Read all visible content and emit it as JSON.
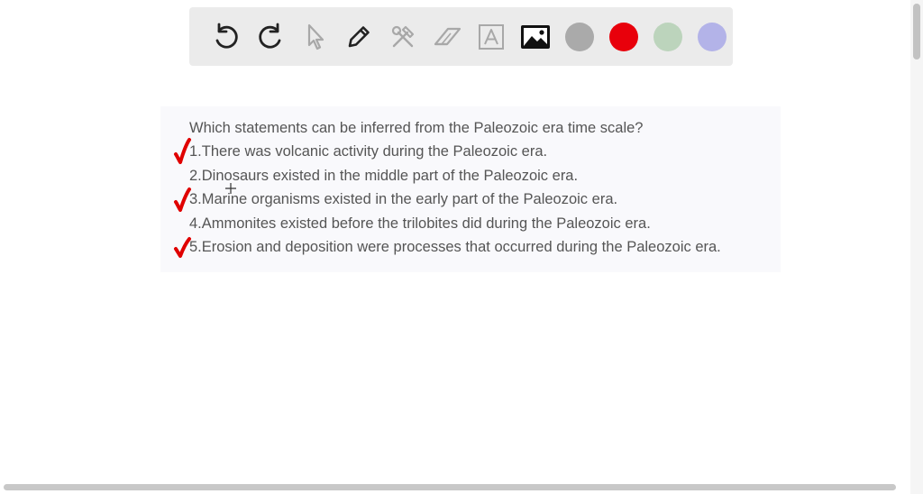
{
  "toolbar": {
    "tools": [
      {
        "name": "undo-icon",
        "enabled": true
      },
      {
        "name": "redo-icon",
        "enabled": true
      },
      {
        "name": "pointer-icon",
        "enabled": false
      },
      {
        "name": "pen-icon",
        "enabled": true
      },
      {
        "name": "tools-icon",
        "enabled": false
      },
      {
        "name": "eraser-icon",
        "enabled": false
      },
      {
        "name": "text-icon",
        "enabled": false
      },
      {
        "name": "image-icon",
        "enabled": true
      }
    ],
    "colors": [
      "#aaaaaa",
      "#e8000b",
      "#bcd4bc",
      "#b3b3e8"
    ]
  },
  "question": {
    "prompt": "Which statements can be inferred from the Paleozoic era time scale?",
    "statements": [
      {
        "text": "1.There was volcanic activity during the Paleozoic era.",
        "checked": true
      },
      {
        "text": "2.Dinosaurs existed in the middle part of the Paleozoic era.",
        "checked": false
      },
      {
        "text": "3.Marine organisms existed in the early part of the Paleozoic era.",
        "checked": true
      },
      {
        "text": "4.Ammonites existed before the trilobites did during the Paleozoic era.",
        "checked": false
      },
      {
        "text": "5.Erosion and deposition were processes that occurred during the Paleozoic era.",
        "checked": true
      }
    ]
  },
  "annotation_color": "#e00000"
}
